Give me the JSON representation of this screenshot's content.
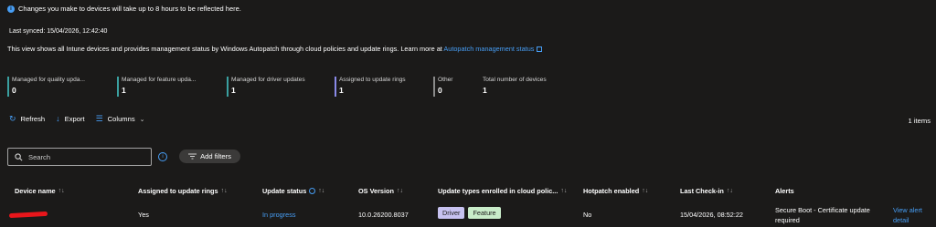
{
  "info": {
    "text": "Changes you make to devices will take up to 8 hours to be reflected here."
  },
  "last_synced": "Last synced: 15/04/2026, 12:42:40",
  "description": {
    "text": "This view shows all Intune devices and provides management status by Windows Autopatch through cloud policies and update rings. Learn more at ",
    "link": "Autopatch management status"
  },
  "stats": [
    {
      "label": "Managed for quality upda...",
      "value": "0",
      "color": "#3aa0a0"
    },
    {
      "label": "Managed for feature upda...",
      "value": "1",
      "color": "#3aa0a0"
    },
    {
      "label": "Managed for driver updates",
      "value": "1",
      "color": "#3aa0a0"
    },
    {
      "label": "Assigned to update rings",
      "value": "1",
      "color": "#8a8ae8"
    },
    {
      "label": "Other",
      "value": "0",
      "color": "#8a8a8a"
    },
    {
      "label": "Total number of devices",
      "value": "1",
      "color": ""
    }
  ],
  "toolbar": {
    "refresh": "Refresh",
    "export": "Export",
    "columns": "Columns",
    "items_count": "1 items"
  },
  "search": {
    "placeholder": "Search"
  },
  "filters": {
    "add_label": "Add filters"
  },
  "table": {
    "headers": {
      "device_name": "Device name",
      "assigned_rings": "Assigned to update rings",
      "update_status": "Update status",
      "os_version": "OS Version",
      "update_types": "Update types enrolled in cloud polic...",
      "hotpatch": "Hotpatch enabled",
      "last_checkin": "Last Check-in",
      "alerts": "Alerts"
    },
    "rows": [
      {
        "assigned_rings": "Yes",
        "update_status": "In progress",
        "os_version": "10.0.26200.8037",
        "update_types": [
          "Driver",
          "Feature"
        ],
        "hotpatch": "No",
        "last_checkin": "15/04/2026, 08:52:22",
        "alert_line1": "Secure Boot - Certificate update",
        "alert_line2": "required",
        "action_line1": "View alert",
        "action_line2": "detail"
      }
    ]
  },
  "colors": {
    "accent": "#479ef5",
    "driver_badge": "#c7c2f0",
    "feature_badge": "#c9ecc9"
  }
}
